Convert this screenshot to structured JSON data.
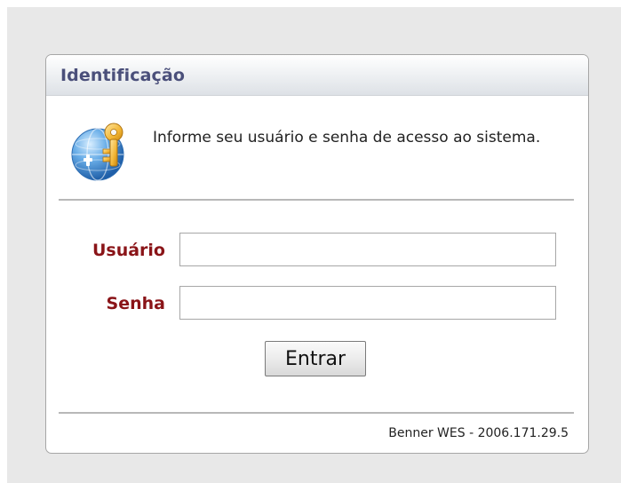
{
  "login_panel": {
    "title": "Identificação",
    "message": "Informe seu usuário e senha de acesso ao sistema.",
    "icon": "globe-key-icon",
    "username": {
      "label": "Usuário",
      "value": ""
    },
    "password": {
      "label": "Senha",
      "value": ""
    },
    "submit_label": "Entrar",
    "footer": "Benner WES - 2006.171.29.5"
  },
  "colors": {
    "label": "#8a1418",
    "title": "#4a4f7a",
    "background": "#e8e8e8"
  }
}
